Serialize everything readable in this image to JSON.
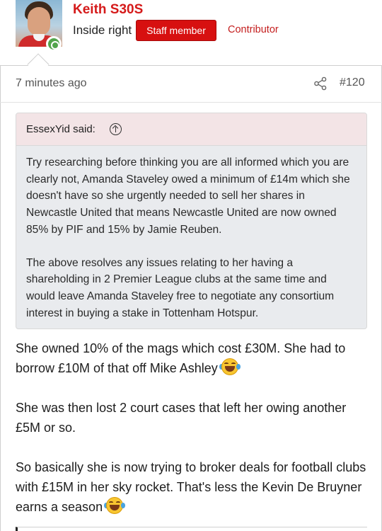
{
  "user": {
    "name": "Keith S30S",
    "title": "Inside right",
    "badge": "Staff member",
    "role": "Contributor",
    "online": true
  },
  "post": {
    "time": "7 minutes ago",
    "number": "#120",
    "share_icon": "share-icon"
  },
  "quote": {
    "author": "EssexYid said:",
    "jump_icon": "arrow-up-circle-icon",
    "paragraphs": [
      "Try researching before thinking you are all informed which you are clearly not, Amanda Staveley owed a minimum of £14m which she doesn't have so she urgently needed to sell her shares in Newcastle United that means Newcastle United are now owned 85% by PIF and 15% by Jamie Reuben.",
      "The above resolves any issues relating to her having a shareholding in 2 Premier League clubs at the same time and would leave Amanda Staveley free to negotiate any consortium interest in buying a stake in Tottenham Hotspur."
    ]
  },
  "body": {
    "paragraphs": [
      "She owned 10% of the mags which cost £30M. She had to borrow £10M of that off Mike Ashley",
      "She was then lost 2 court cases that left her owing another £5M or so.",
      "So basically she is now trying to broker deals for football clubs with £15M in her sky rocket. That's less the Kevin De Bruyner earns a season"
    ],
    "emoji": "laughing-with-tears-emoji"
  },
  "colors": {
    "accent": "#d51a1a",
    "badge_bg": "#d71010",
    "quote_head_bg": "#f3e4e6",
    "quote_body_bg": "#e9ebee",
    "online": "#52a54b"
  }
}
